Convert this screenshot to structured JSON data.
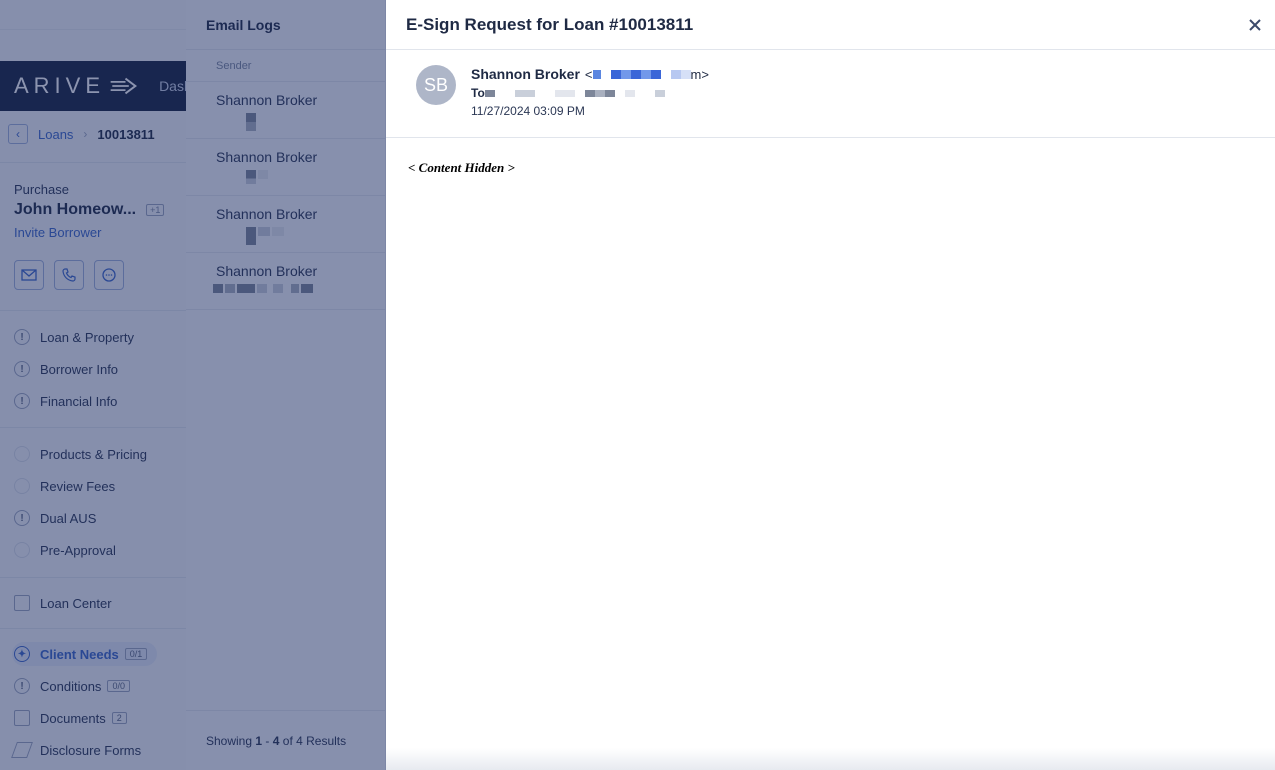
{
  "app": {
    "logo": "ARIVE",
    "dash_label": "Dash",
    "breadcrumb": {
      "loans": "Loans",
      "loan_id": "10013811"
    },
    "loan_type": "Purchase",
    "borrower_name": "John Homeow...",
    "borrower_extra": "+1",
    "invite_label": "Invite Borrower",
    "nav": {
      "loan_property": "Loan & Property",
      "borrower_info": "Borrower Info",
      "financial_info": "Financial Info",
      "products_pricing": "Products & Pricing",
      "review_fees": "Review Fees",
      "dual_aus": "Dual AUS",
      "pre_approval": "Pre-Approval",
      "loan_center": "Loan Center",
      "client_needs": "Client Needs",
      "client_needs_count": "0/1",
      "conditions": "Conditions",
      "conditions_count": "0/0",
      "documents": "Documents",
      "documents_count": "2",
      "disclosure_forms": "Disclosure Forms"
    }
  },
  "logs": {
    "title": "Email Logs",
    "column_sender": "Sender",
    "rows": [
      {
        "sender": "Shannon Broker"
      },
      {
        "sender": "Shannon Broker"
      },
      {
        "sender": "Shannon Broker"
      },
      {
        "sender": "Shannon Broker"
      }
    ],
    "footer": {
      "prefix": "Showing",
      "range_start": "1",
      "dash": "-",
      "range_end": "4",
      "of_label": "of 4 Results"
    }
  },
  "detail": {
    "title": "E-Sign Request for Loan #10013811",
    "avatar_initials": "SB",
    "from_name": "Shannon Broker",
    "from_open": "<",
    "from_close": "m>",
    "to_label": "To",
    "date": "11/27/2024 03:09 PM",
    "body": "< Content Hidden >"
  },
  "colors": {
    "primary": "#3a66c8",
    "logo_bar": "#17223f",
    "overlay": "rgba(26, 42, 96, 0.50)",
    "avatar": "#aeb6c8"
  },
  "icons": [
    "back-chevron-icon",
    "mail-icon",
    "phone-icon",
    "chat-icon",
    "alert-icon",
    "loan-center-icon",
    "client-needs-icon",
    "conditions-icon",
    "documents-icon",
    "disclosure-icon",
    "close-icon"
  ]
}
